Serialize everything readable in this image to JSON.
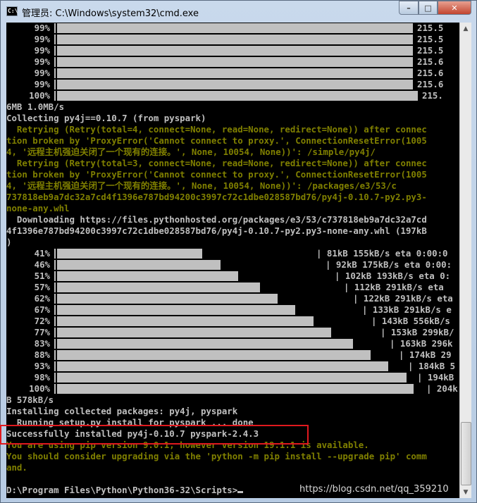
{
  "window": {
    "icon_label": "C:\\",
    "title": "管理员: C:\\Windows\\system32\\cmd.exe",
    "min_glyph": "–",
    "max_glyph": "□",
    "close_glyph": "✕"
  },
  "top_progress": [
    {
      "pct": "99%",
      "tail": "215.5"
    },
    {
      "pct": "99%",
      "tail": "215.5"
    },
    {
      "pct": "99%",
      "tail": "215.5"
    },
    {
      "pct": "99%",
      "tail": "215.6"
    },
    {
      "pct": "99%",
      "tail": "215.6"
    },
    {
      "pct": "99%",
      "tail": "215.6"
    },
    {
      "pct": "100%",
      "tail": "215."
    }
  ],
  "lines_mid": [
    {
      "text": "6MB 1.0MB/s",
      "color": "white"
    },
    {
      "text": "Collecting py4j==0.10.7 (from pyspark)",
      "color": "white"
    },
    {
      "text": "  Retrying (Retry(total=4, connect=None, read=None, redirect=None)) after connec",
      "color": "yellow"
    },
    {
      "text": "tion broken by 'ProxyError('Cannot connect to proxy.', ConnectionResetError(1005",
      "color": "yellow"
    },
    {
      "text": "4, '远程主机强迫关闭了一个现有的连接。', None, 10054, None))': /simple/py4j/",
      "color": "yellow"
    },
    {
      "text": "  Retrying (Retry(total=3, connect=None, read=None, redirect=None)) after connec",
      "color": "yellow"
    },
    {
      "text": "tion broken by 'ProxyError('Cannot connect to proxy.', ConnectionResetError(1005",
      "color": "yellow"
    },
    {
      "text": "4, '远程主机强迫关闭了一个现有的连接。', None, 10054, None))': /packages/e3/53/c",
      "color": "yellow"
    },
    {
      "text": "737818eb9a7dc32a7cd4f1396e787bd94200c3997c72c1dbe028587bd76/py4j-0.10.7-py2.py3-",
      "color": "yellow"
    },
    {
      "text": "none-any.whl",
      "color": "yellow"
    },
    {
      "text": "  Downloading https://files.pythonhosted.org/packages/e3/53/c737818eb9a7dc32a7cd",
      "color": "white"
    },
    {
      "text": "4f1396e787bd94200c3997c72c1dbe028587bd76/py4j-0.10.7-py2.py3-none-any.whl (197kB",
      "color": "white"
    },
    {
      "text": ")",
      "color": "white"
    }
  ],
  "download_progress": [
    {
      "pct": "41%",
      "fraction": 0.41,
      "stat": "| 81kB 155kB/s eta 0:00:0"
    },
    {
      "pct": "46%",
      "fraction": 0.46,
      "stat": "| 92kB 175kB/s eta 0:00:"
    },
    {
      "pct": "51%",
      "fraction": 0.51,
      "stat": "| 102kB 193kB/s eta 0:"
    },
    {
      "pct": "57%",
      "fraction": 0.57,
      "stat": "| 112kB 291kB/s eta"
    },
    {
      "pct": "62%",
      "fraction": 0.62,
      "stat": "| 122kB 291kB/s eta"
    },
    {
      "pct": "67%",
      "fraction": 0.67,
      "stat": "| 133kB 291kB/s e"
    },
    {
      "pct": "72%",
      "fraction": 0.72,
      "stat": "| 143kB 556kB/s"
    },
    {
      "pct": "77%",
      "fraction": 0.77,
      "stat": "| 153kB 299kB/"
    },
    {
      "pct": "83%",
      "fraction": 0.83,
      "stat": "| 163kB 296k"
    },
    {
      "pct": "88%",
      "fraction": 0.88,
      "stat": "| 174kB 29"
    },
    {
      "pct": "93%",
      "fraction": 0.93,
      "stat": "| 184kB 5"
    },
    {
      "pct": "98%",
      "fraction": 0.98,
      "stat": "| 194kB"
    },
    {
      "pct": "100%",
      "fraction": 1.0,
      "stat": "| 204k"
    }
  ],
  "lines_end": [
    {
      "text": "B 578kB/s",
      "color": "white"
    },
    {
      "text": "Installing collected packages: py4j, pyspark",
      "color": "white"
    },
    {
      "text": "  Running setup.py install for pyspark ... done",
      "color": "white"
    },
    {
      "text": "Successfully installed py4j-0.10.7 pyspark-2.4.3",
      "color": "white"
    },
    {
      "text": "You are using pip version 9.0.1, however version 19.1.1 is available.",
      "color": "yellow"
    },
    {
      "text": "You should consider upgrading via the 'python -m pip install --upgrade pip' comm",
      "color": "yellow"
    },
    {
      "text": "and.",
      "color": "yellow"
    },
    {
      "text": "",
      "color": "white"
    }
  ],
  "prompt": "D:\\Program Files\\Python\\Python36-32\\Scripts>",
  "watermark": "https://blog.csdn.net/qq_359210",
  "colors": {
    "console_bg": "#000000",
    "text_white": "#c0c0c0",
    "text_yellow": "#808000",
    "highlight": "#e0191e"
  }
}
